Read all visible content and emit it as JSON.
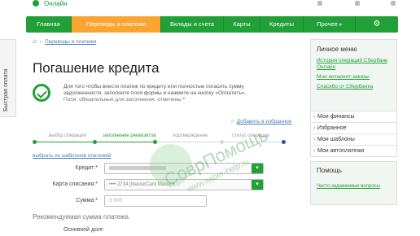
{
  "header": {
    "brand_partial": "Онлайн"
  },
  "nav": {
    "items": [
      {
        "label": "Главная",
        "active": false,
        "w": 56
      },
      {
        "label": "Переводы и платежи",
        "active": true,
        "w": 110
      },
      {
        "label": "Вклады и счета",
        "active": false,
        "w": 77
      },
      {
        "label": "Карты",
        "active": false,
        "w": 45
      },
      {
        "label": "Кредиты",
        "active": false,
        "w": 53
      },
      {
        "label": "Прочее",
        "active": false,
        "w": 64,
        "caret": "▾"
      }
    ],
    "gear_icon": "gear-icon"
  },
  "sidetab": {
    "label": "Быстрая оплата"
  },
  "breadcrumb": {
    "home_icon": "home-icon",
    "link": "Переводы и платежи"
  },
  "page": {
    "title": "Погашение кредита",
    "info_text": "Для того чтобы внести платеж по кредиту или полностью погасить сумму задолженности, заполните поля формы и нажмите на кнопку «Оплатить».",
    "required_note": "Поля, обязательные для заполнения, отмечены",
    "required_star": "*",
    "favorite_link": "Добавить в избранное"
  },
  "steps": [
    {
      "label": "выбор операции",
      "state": "done"
    },
    {
      "label": "заполнение реквизитов",
      "state": "current"
    },
    {
      "label": "подтверждение",
      "state": "todo"
    },
    {
      "label": "статус операции",
      "state": "todo"
    }
  ],
  "form": {
    "templates_link": "выбрать из шаблонов платежей",
    "credit_label": "Кредит:",
    "card_label": "Карта списания:",
    "card_value": "•••• 2734  [MasterCard Mass] 5 ...",
    "amount_label": "Сумма:",
    "amount_placeholder": "3 000",
    "star": "*",
    "select_button_icon": "chevron-down-icon"
  },
  "recommended": {
    "heading": "Рекомендуемая сумма платежа",
    "main_debt_label": "Основной долг:"
  },
  "personal_menu": {
    "title": "Личное меню",
    "links": [
      "История операций Сбербанк Онлайн",
      "Мои интернет-заказы",
      "Спасибо от Сбербанка"
    ],
    "items": [
      "Мои финансы",
      "Избранное",
      "Мои шаблоны",
      "Мои автоплатежи"
    ]
  },
  "help": {
    "title": "Помощь",
    "link": "Часто задаваемые вопросы"
  },
  "watermark": {
    "text": "СоврПомощь",
    "url": "www.saber-help.ru"
  },
  "colors": {
    "brand_green": "#21a038",
    "active_tab": "#f8a532",
    "link": "#4a7fb5"
  }
}
